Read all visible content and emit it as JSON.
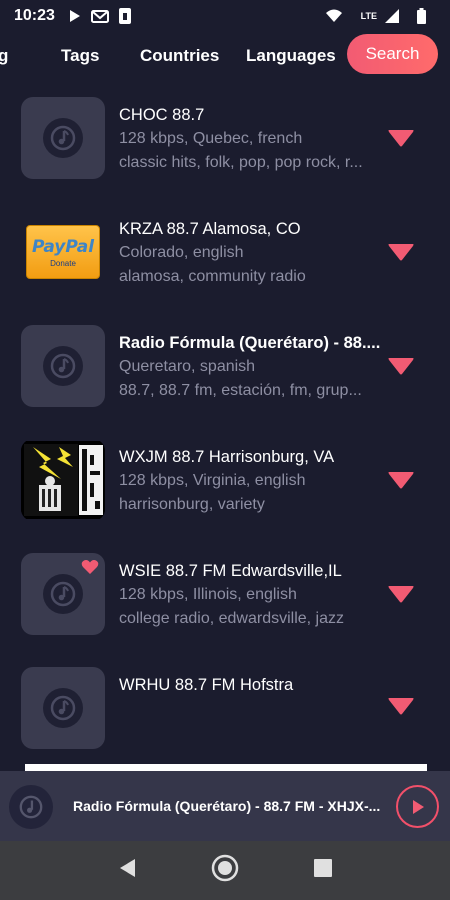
{
  "status": {
    "time": "10:23",
    "network": "LTE"
  },
  "tabs": {
    "partial": "g",
    "tags": "Tags",
    "countries": "Countries",
    "languages": "Languages",
    "search": "Search"
  },
  "stations": [
    {
      "title": "CHOC 88.7",
      "subtitle": "128 kbps, Quebec, french",
      "tags": "classic hits, folk, pop, pop rock, r...",
      "logo": "disc-icon",
      "favorite": false
    },
    {
      "title": "KRZA 88.7 Alamosa, CO",
      "subtitle": "Colorado, english",
      "tags": "alamosa, community radio",
      "logo": "paypal-donate",
      "favorite": false
    },
    {
      "title": "Radio Fórmula (Querétaro) - 88....",
      "subtitle": "Queretaro, spanish",
      "tags": "88.7, 88.7 fm, estación, fm, grup...",
      "logo": "disc-icon",
      "favorite": false
    },
    {
      "title": "WXJM 88.7 Harrisonburg, VA",
      "subtitle": "128 kbps, Virginia, english",
      "tags": "harrisonburg, variety",
      "logo": "wxjm-logo",
      "favorite": false
    },
    {
      "title": "WSIE 88.7 FM Edwardsville,IL",
      "subtitle": "128 kbps, Illinois, english",
      "tags": "college radio, edwardsville, jazz",
      "logo": "disc-icon",
      "favorite": true
    },
    {
      "title": "WRHU 88.7 FM Hofstra",
      "subtitle": "",
      "tags": "",
      "logo": "disc-icon",
      "favorite": false
    }
  ],
  "paypal": {
    "brand_1": "Pay",
    "brand_2": "Pal",
    "donate": "Donate"
  },
  "player": {
    "title": "Radio Fórmula (Querétaro) - 88.7 FM - XHJX-..."
  },
  "colors": {
    "background": "#1b1c2e",
    "accent": "#f25b73",
    "muted_text": "#8e8fa3",
    "tile": "#3a3b4f"
  }
}
